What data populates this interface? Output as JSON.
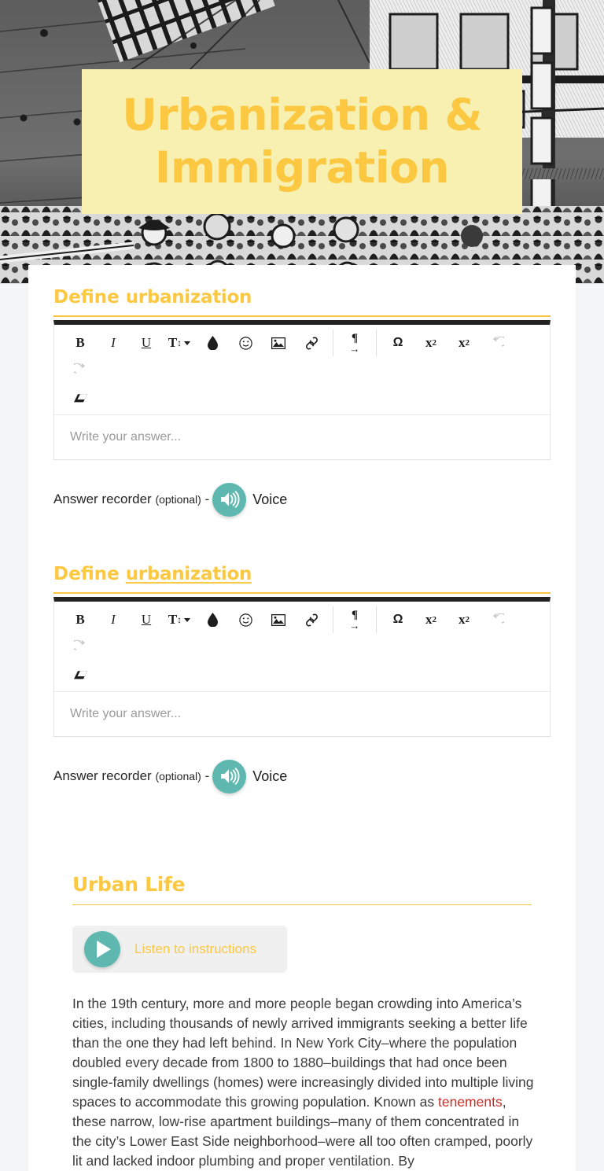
{
  "colors": {
    "accent_yellow": "#fcc842",
    "banner_bg": "#f7f0b0",
    "teal": "#5fb8b0",
    "highlight_red": "#cf2c24",
    "page_bg": "#f4f5f7",
    "editor_top_bar": "#232323"
  },
  "hero": {
    "banner_title_line1": "Urbanization &",
    "banner_title_line2": "Immigration",
    "image_alt": "historic-engraving-immigrants-ship"
  },
  "questions": [
    {
      "heading_lead": "Define ",
      "heading_term": "urbanization",
      "term_underlined": false,
      "editor": {
        "placeholder": "Write your answer...",
        "value": "",
        "toolbar": [
          {
            "name": "bold-icon",
            "glyph": "B",
            "style": "bold-serif",
            "enabled": true
          },
          {
            "name": "italic-icon",
            "glyph": "I",
            "style": "italic-serif",
            "enabled": true
          },
          {
            "name": "underline-icon",
            "glyph": "U",
            "style": "underline-serif",
            "enabled": true
          },
          {
            "name": "text-size-icon",
            "glyph": "T",
            "style": "size",
            "enabled": true,
            "has_caret": true
          },
          {
            "name": "text-color-droplet-icon",
            "glyph": "droplet",
            "style": "svg",
            "enabled": true
          },
          {
            "name": "emoji-icon",
            "glyph": "smiley",
            "style": "svg",
            "enabled": true
          },
          {
            "name": "insert-image-icon",
            "glyph": "image",
            "style": "svg",
            "enabled": true
          },
          {
            "name": "insert-link-icon",
            "glyph": "link",
            "style": "svg",
            "enabled": true
          },
          {
            "name": "paragraph-direction-icon",
            "glyph": "pilcrow-arrow",
            "style": "svg",
            "enabled": true,
            "sep_before": true,
            "sep_after": true
          },
          {
            "name": "special-character-icon",
            "glyph": "Ω",
            "style": "sans",
            "enabled": true
          },
          {
            "name": "subscript-icon",
            "glyph": "x2",
            "style": "sub",
            "enabled": true
          },
          {
            "name": "superscript-icon",
            "glyph": "x2",
            "style": "sup",
            "enabled": true
          },
          {
            "name": "undo-icon",
            "glyph": "undo",
            "style": "svg",
            "enabled": false
          },
          {
            "name": "redo-icon",
            "glyph": "redo",
            "style": "svg",
            "enabled": false
          },
          {
            "name": "clear-formatting-eraser-icon",
            "glyph": "eraser",
            "style": "svg",
            "enabled": true,
            "row": 2
          }
        ]
      },
      "recorder": {
        "label": "Answer recorder ",
        "optional": "(optional)",
        "dash": " -",
        "voice_label": "Voice",
        "icon": "speaker-icon"
      }
    },
    {
      "heading_lead": "Define ",
      "heading_term": "urbanization",
      "term_underlined": true,
      "editor": {
        "placeholder": "Write your answer...",
        "value": "",
        "toolbar": [
          {
            "name": "bold-icon",
            "glyph": "B",
            "style": "bold-serif",
            "enabled": true
          },
          {
            "name": "italic-icon",
            "glyph": "I",
            "style": "italic-serif",
            "enabled": true
          },
          {
            "name": "underline-icon",
            "glyph": "U",
            "style": "underline-serif",
            "enabled": true
          },
          {
            "name": "text-size-icon",
            "glyph": "T",
            "style": "size",
            "enabled": true,
            "has_caret": true
          },
          {
            "name": "text-color-droplet-icon",
            "glyph": "droplet",
            "style": "svg",
            "enabled": true
          },
          {
            "name": "emoji-icon",
            "glyph": "smiley",
            "style": "svg",
            "enabled": true
          },
          {
            "name": "insert-image-icon",
            "glyph": "image",
            "style": "svg",
            "enabled": true
          },
          {
            "name": "insert-link-icon",
            "glyph": "link",
            "style": "svg",
            "enabled": true
          },
          {
            "name": "paragraph-direction-icon",
            "glyph": "pilcrow-arrow",
            "style": "svg",
            "enabled": true,
            "sep_before": true,
            "sep_after": true
          },
          {
            "name": "special-character-icon",
            "glyph": "Ω",
            "style": "sans",
            "enabled": true
          },
          {
            "name": "subscript-icon",
            "glyph": "x2",
            "style": "sub",
            "enabled": true
          },
          {
            "name": "superscript-icon",
            "glyph": "x2",
            "style": "sup",
            "enabled": true
          },
          {
            "name": "undo-icon",
            "glyph": "undo",
            "style": "svg",
            "enabled": false
          },
          {
            "name": "redo-icon",
            "glyph": "redo",
            "style": "svg",
            "enabled": false
          },
          {
            "name": "clear-formatting-eraser-icon",
            "glyph": "eraser",
            "style": "svg",
            "enabled": true,
            "row": 2
          }
        ]
      },
      "recorder": {
        "label": "Answer recorder ",
        "optional": "(optional)",
        "dash": " -",
        "voice_label": "Voice",
        "icon": "speaker-icon"
      }
    }
  ],
  "urban_life": {
    "heading": "Urban Life",
    "listen_button_label": "Listen to instructions",
    "listen_button_icon": "play-icon",
    "paragraph_part1": "In the 19th century, more and more people began crowding into America’s cities, including thousands of newly arrived immigrants seeking a better life than the one they had left behind. In New York City–where the population doubled every decade from 1800 to 1880–buildings that had once been single-family dwellings (homes) were increasingly divided into multiple living spaces to accommodate this growing population. Known as ",
    "highlight_term": "tenements",
    "paragraph_part2": ", these narrow, low-rise apartment buildings–many of them concentrated in the city’s Lower East Side neighborhood–were all too often cramped, poorly lit and lacked indoor plumbing and proper ventilation. By"
  }
}
